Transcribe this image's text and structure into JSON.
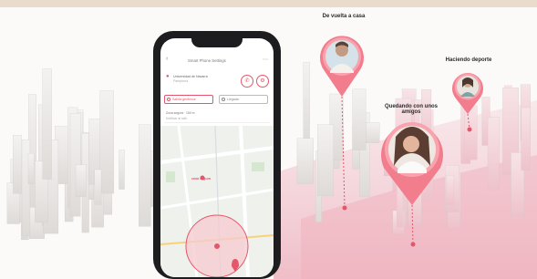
{
  "banner": {
    "callouts": [
      {
        "label": "De vuelta a casa",
        "avatar": "man-portrait-photo"
      },
      {
        "label": "Haciendo deporte",
        "avatar": "woman-sport-portrait-photo"
      },
      {
        "label": "Quedando con unos amigos",
        "avatar": "woman-smiling-portrait-photo"
      }
    ]
  },
  "phone": {
    "app_title": "Smart Phone Settings",
    "address_line1": "Universidad de Navarra",
    "address_line2": "Pamplona",
    "safe_zone_chip": "Salida geofence",
    "entry_chip": "Llegada",
    "settings_label": "Zona segura · 150 m",
    "settings_value": "Notificar al salir",
    "zone_label": "zona segura",
    "icons": [
      "back-arrow-icon",
      "menu-icon",
      "location-pin-icon",
      "phone-icon",
      "settings-icon"
    ]
  },
  "colors": {
    "accent": "#e4576a",
    "pin_pink": "#f27d8c",
    "zone_fill": "#f6c9d0"
  }
}
